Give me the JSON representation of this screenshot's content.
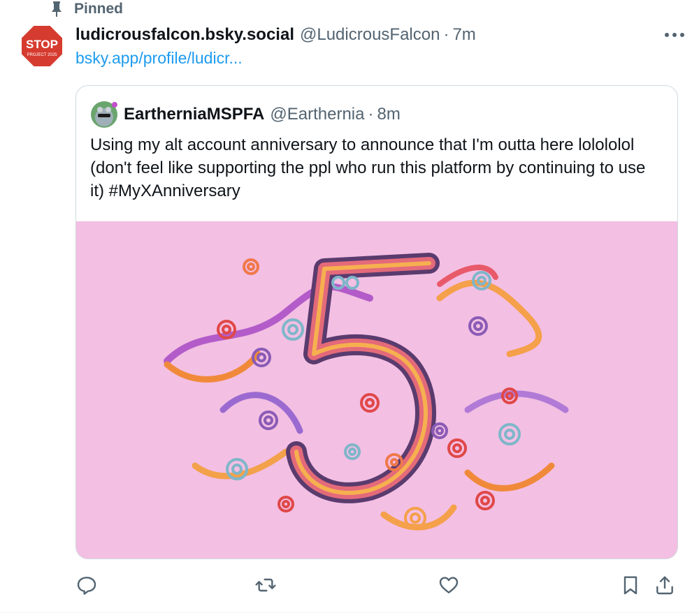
{
  "pinned": {
    "label": "Pinned",
    "icon": "pin-icon"
  },
  "post": {
    "author_name": "ludicrousfalcon.bsky.social",
    "author_handle": "@LudicrousFalcon",
    "separator": "·",
    "time": "7m",
    "link_text": "bsky.app/profile/ludicr...",
    "avatar": {
      "top": "STOP",
      "bottom": "PROJECT 2025",
      "color": "#d63b2f"
    }
  },
  "quote": {
    "author_name": "EartherniaMSPFA",
    "author_handle": "@Earthernia",
    "separator": "·",
    "time": "8m",
    "text": "Using my alt account anniversary to announce that I'm outta here lolololol (don't feel like supporting the ppl who run this platform by continuing to use it)  #MyXAnniversary",
    "image": {
      "subject": "quilled paper number 5",
      "background_color": "#f3bfe3"
    }
  },
  "actions": [
    {
      "name": "reply",
      "icon": "reply-icon"
    },
    {
      "name": "repost",
      "icon": "repost-icon"
    },
    {
      "name": "like",
      "icon": "heart-icon"
    },
    {
      "name": "bookmark",
      "icon": "bookmark-icon"
    },
    {
      "name": "share",
      "icon": "share-icon"
    }
  ],
  "colors": {
    "link": "#1d9bf0",
    "muted": "#536471",
    "text": "#0f1419",
    "border": "#cfd9de"
  }
}
